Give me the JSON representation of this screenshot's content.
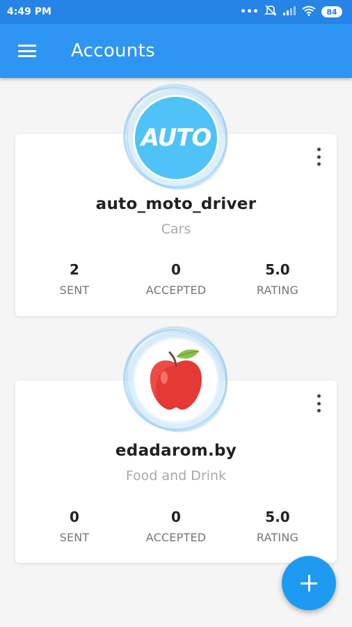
{
  "status_bar": {
    "time": "4:49 PM",
    "battery": "84",
    "icons": [
      "more-dots-icon",
      "mute-icon",
      "signal-icon",
      "wifi-icon",
      "battery-icon"
    ]
  },
  "app_bar": {
    "title": "Accounts",
    "menu_icon": "hamburger-menu-icon"
  },
  "accounts": [
    {
      "avatar_text": "AUTO",
      "name": "auto_moto_driver",
      "category": "Cars",
      "stats": [
        {
          "value": "2",
          "label": "SENT"
        },
        {
          "value": "0",
          "label": "ACCEPTED"
        },
        {
          "value": "5.0",
          "label": "RATING"
        }
      ]
    },
    {
      "avatar_icon": "apple-icon",
      "name": "edadarom.by",
      "category": "Food and Drink",
      "stats": [
        {
          "value": "0",
          "label": "SENT"
        },
        {
          "value": "0",
          "label": "ACCEPTED"
        },
        {
          "value": "5.0",
          "label": "RATING"
        }
      ]
    }
  ],
  "fab": {
    "icon": "plus-icon"
  },
  "colors": {
    "status_bar": "#2584e6",
    "app_bar": "#2f95f3",
    "fab": "#1e9bf0",
    "auto_avatar": "#4fc3f7"
  }
}
